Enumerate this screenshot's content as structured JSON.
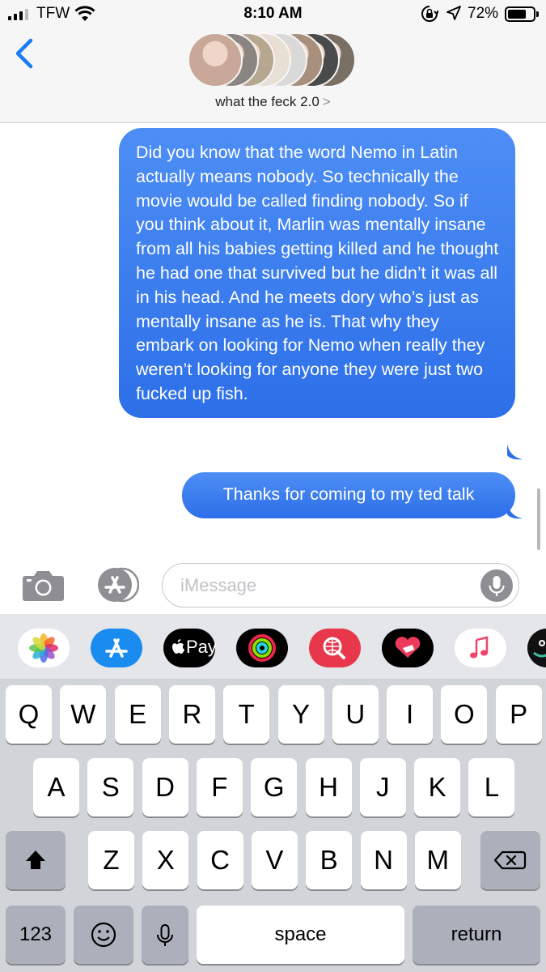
{
  "status_bar": {
    "carrier": "TFW",
    "time": "8:10 AM",
    "battery_percent": "72%",
    "battery_level": 0.72,
    "icons": [
      "signal-bars-icon",
      "wifi-icon",
      "rotation-lock-icon",
      "location-arrow-icon",
      "battery-icon"
    ]
  },
  "header": {
    "back_icon": "chevron-left-icon",
    "group_name": "what the feck 2.0",
    "group_chevron": ">",
    "avatar_count": 8,
    "avatar_colors": [
      "#c9a89a",
      "#8a8580",
      "#b8a790",
      "#e8e0d5",
      "#d9d9d9",
      "#a88f7c",
      "#4a4a4a",
      "#7a6f64"
    ]
  },
  "messages": [
    {
      "sender": "me",
      "text": "Did you know that the word Nemo in Latin actually means nobody. So technically the movie would be called finding nobody. So if you think about it, Marlin was mentally insane from all his babies getting killed and he thought he had one that survived but he didn’t it was all in his head. And he meets dory who’s just as mentally insane as he is. That why they embark on looking for Nemo when really they weren’t looking for anyone they were just two fucked up fish."
    },
    {
      "sender": "me",
      "text": "Thanks for coming to my ted talk"
    }
  ],
  "compose": {
    "placeholder": "iMessage",
    "value": "",
    "camera_icon": "camera-icon",
    "apps_icon": "app-store-icon",
    "mic_icon": "microphone-icon"
  },
  "app_drawer": [
    {
      "name": "photos",
      "icon": "photos-icon",
      "bg": "#ffffff"
    },
    {
      "name": "app-store",
      "icon": "app-store-icon",
      "bg": "#1a8cf0"
    },
    {
      "name": "apple-pay",
      "icon": "apple-pay-icon",
      "label": "Pay",
      "bg": "#000000"
    },
    {
      "name": "activity",
      "icon": "activity-rings-icon",
      "bg": "#000000"
    },
    {
      "name": "image-search",
      "icon": "globe-search-icon",
      "bg": "#e8374a"
    },
    {
      "name": "digital-touch",
      "icon": "heart-hand-icon",
      "bg": "#000000"
    },
    {
      "name": "music",
      "icon": "music-note-icon",
      "bg": "#ffffff"
    }
  ],
  "keyboard": {
    "row1": [
      "Q",
      "W",
      "E",
      "R",
      "T",
      "Y",
      "U",
      "I",
      "O",
      "P"
    ],
    "row2": [
      "A",
      "S",
      "D",
      "F",
      "G",
      "H",
      "J",
      "K",
      "L"
    ],
    "row3": [
      "Z",
      "X",
      "C",
      "V",
      "B",
      "N",
      "M"
    ],
    "shift_icon": "shift-arrow-icon",
    "delete_icon": "backspace-icon",
    "numbers_label": "123",
    "emoji_icon": "emoji-icon",
    "dictation_icon": "microphone-icon",
    "space_label": "space",
    "return_label": "return"
  },
  "colors": {
    "bubble_blue": "#2d6fe8",
    "ios_blue": "#1a7cf5",
    "keyboard_bg": "#d1d4d9",
    "header_bg": "#f6f6f6"
  }
}
